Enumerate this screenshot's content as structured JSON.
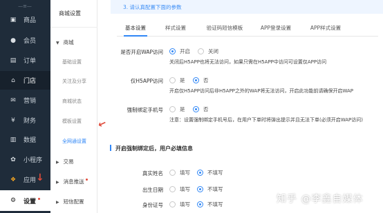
{
  "nav1": {
    "top_label": "—≡—",
    "items": [
      {
        "label": "商品",
        "icon": "product-icon",
        "glyph": "▣"
      },
      {
        "label": "会员",
        "icon": "member-icon",
        "glyph": "●"
      },
      {
        "label": "订单",
        "icon": "order-icon",
        "glyph": "▤"
      },
      {
        "label": "门店",
        "icon": "store-icon",
        "glyph": "⌂"
      },
      {
        "label": "营销",
        "icon": "marketing-icon",
        "glyph": "✉"
      },
      {
        "label": "财务",
        "icon": "finance-icon",
        "glyph": "¥"
      },
      {
        "label": "数据",
        "icon": "data-icon",
        "glyph": "▥"
      },
      {
        "label": "小程序",
        "icon": "mini-program-icon",
        "glyph": "✿"
      },
      {
        "label": "应用",
        "icon": "apps-icon",
        "glyph": "❖"
      },
      {
        "label": "设置",
        "icon": "settings-icon",
        "glyph": "⚙"
      }
    ]
  },
  "nav2": {
    "title": "商城设置",
    "group_mall": "商城",
    "subs": [
      "基础设置",
      "关注及分享",
      "商城状态",
      "模板设置",
      "全网通设置"
    ],
    "group_trade": "交易",
    "group_message": "消息推送",
    "group_sms": "短信配置"
  },
  "main": {
    "notice": "3. 请认真配置下面的参数",
    "tabs": [
      "基本设置",
      "样式设置",
      "验证码短信模板",
      "APP登录设置",
      "APP样式设置"
    ],
    "row1": {
      "label": "是否开启WAP访问",
      "opt_on": "开启",
      "opt_off": "关闭",
      "hint": "关闭后H5APP也将无法访问，如果只需在H5APP中访问可设置仅APP访问"
    },
    "row2": {
      "label": "仅H5APP访问",
      "opt_yes": "是",
      "opt_no": "否",
      "hint": "开启仅H5APP访问后非H5APP之外的WAP将无法访问，开启此功能前请确保开启WAP"
    },
    "row3": {
      "label": "强制绑定手机号",
      "opt_yes": "是",
      "opt_no": "否",
      "hint": "注意：设置强制绑定手机号后，在用户下单时将弹出提示并且无法下单(必须开启WAP访问)"
    },
    "section_title": "开启强制绑定后，用户必填信息",
    "fields": [
      {
        "label": "真实姓名",
        "opt_fill": "填写",
        "opt_nofill": "不填写"
      },
      {
        "label": "出生日期",
        "opt_fill": "填写",
        "opt_nofill": "不填写"
      },
      {
        "label": "身份证号",
        "opt_fill": "填写",
        "opt_nofill": "不填写"
      }
    ]
  },
  "watermark": "知乎 @李鑫自媒体",
  "colors": {
    "accent": "#2f86f6",
    "sidebar": "#1f2c3a",
    "alert": "#e24a3b"
  }
}
